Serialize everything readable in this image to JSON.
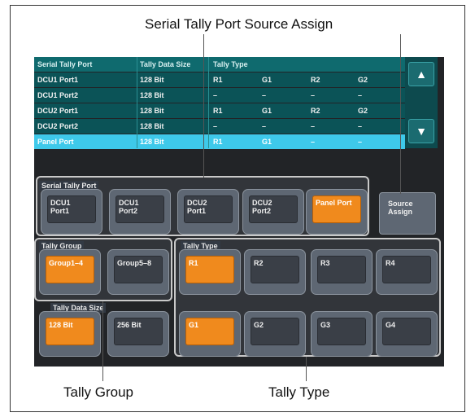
{
  "callouts": {
    "source_assign": "Serial Tally Port Source Assign",
    "tally_group": "Tally Group",
    "tally_type": "Tally Type"
  },
  "table": {
    "headers": [
      "Serial Tally Port",
      "Tally Data Size",
      "Tally Type"
    ],
    "rows": [
      {
        "port": "DCU1 Port1",
        "size": "128 Bit",
        "t1": "R1",
        "t2": "G1",
        "t3": "R2",
        "t4": "G2"
      },
      {
        "port": "DCU1 Port2",
        "size": "128 Bit",
        "t1": "–",
        "t2": "–",
        "t3": "–",
        "t4": "–"
      },
      {
        "port": "DCU2 Port1",
        "size": "128 Bit",
        "t1": "R1",
        "t2": "G1",
        "t3": "R2",
        "t4": "G2"
      },
      {
        "port": "DCU2 Port2",
        "size": "128 Bit",
        "t1": "–",
        "t2": "–",
        "t3": "–",
        "t4": "–"
      },
      {
        "port": "Panel Port",
        "size": "128 Bit",
        "t1": "R1",
        "t2": "G1",
        "t3": "–",
        "t4": "–"
      }
    ]
  },
  "scroll": {
    "up": "▲",
    "down": "▼"
  },
  "serial_tally_port": {
    "title": "Serial Tally Port",
    "buttons": [
      {
        "line1": "DCU1",
        "line2": "Port1"
      },
      {
        "line1": "DCU1",
        "line2": "Port2"
      },
      {
        "line1": "DCU2",
        "line2": "Port1"
      },
      {
        "line1": "DCU2",
        "line2": "Port2"
      },
      {
        "line1": "Panel Port",
        "line2": ""
      }
    ]
  },
  "source_assign": {
    "line1": "Source",
    "line2": "Assign"
  },
  "tally_group": {
    "title": "Tally Group",
    "buttons": [
      "Group1–4",
      "Group5–8"
    ]
  },
  "tally_data_size": {
    "title": "Tally Data Size",
    "buttons": [
      "128 Bit",
      "256 Bit"
    ]
  },
  "tally_type": {
    "title": "Tally Type",
    "buttons": [
      "R1",
      "R2",
      "R3",
      "R4",
      "G1",
      "G2",
      "G3",
      "G4"
    ]
  }
}
